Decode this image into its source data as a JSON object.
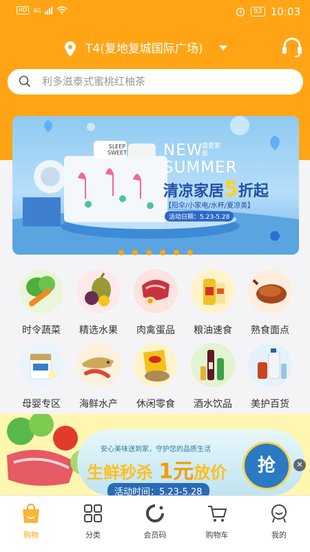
{
  "colors": {
    "accent": "#FFA515"
  },
  "status_bar": {
    "hd": "HD",
    "network": "4G",
    "battery": "92",
    "time": "10:03"
  },
  "location": {
    "store": "T4(复地复城国际广场)"
  },
  "search": {
    "placeholder": "利多滋泰式蜜桃红柚茶"
  },
  "banner": {
    "title_en_1": "NEW",
    "title_en_2": "SUMMER",
    "badge": "盛夏家居",
    "title_cn": "清凉家居",
    "discount_num": "5",
    "discount_unit": "折起",
    "subtitle": "【阳伞/小家电/水杯/夏凉类】",
    "date": "活动日期：5.23-5.28",
    "pillow_text": "SLEEP SWEET",
    "dots": 6
  },
  "categories": [
    {
      "label": "时令蔬菜",
      "icon": "vegetables-icon"
    },
    {
      "label": "精选水果",
      "icon": "fruit-icon"
    },
    {
      "label": "肉禽蛋品",
      "icon": "meat-egg-icon"
    },
    {
      "label": "粮油速食",
      "icon": "grain-oil-icon"
    },
    {
      "label": "熟食面点",
      "icon": "deli-icon"
    },
    {
      "label": "母婴专区",
      "icon": "baby-formula-icon"
    },
    {
      "label": "海鲜水产",
      "icon": "seafood-icon"
    },
    {
      "label": "休闲零食",
      "icon": "snacks-icon"
    },
    {
      "label": "酒水饮品",
      "icon": "drinks-icon"
    },
    {
      "label": "美护百货",
      "icon": "beauty-care-icon"
    }
  ],
  "promo": {
    "tagline": "安心美味送到家，守护您的品质生活",
    "headline_a": "生鲜秒杀",
    "headline_b": "1元",
    "headline_c": "放价",
    "time": "活动时间：5.23-5.28",
    "grab": "抢"
  },
  "tabbar": [
    {
      "label": "购物",
      "icon": "shopping-bag-icon",
      "active": true
    },
    {
      "label": "分类",
      "icon": "category-grid-icon",
      "active": false
    },
    {
      "label": "会员码",
      "icon": "member-code-icon",
      "active": false
    },
    {
      "label": "购物车",
      "icon": "cart-icon",
      "active": false
    },
    {
      "label": "我的",
      "icon": "profile-icon",
      "active": false
    }
  ]
}
